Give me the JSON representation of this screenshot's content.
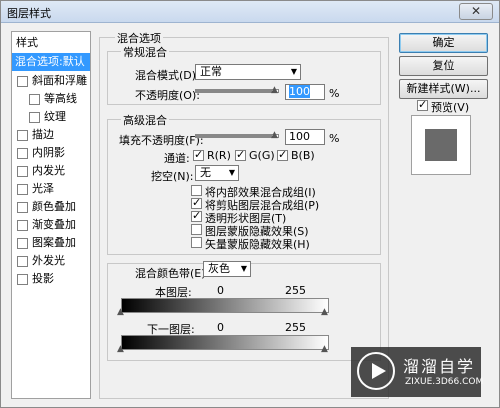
{
  "window": {
    "title": "图层样式",
    "close": "✕"
  },
  "stylelist": {
    "header": "样式",
    "items": [
      {
        "label": "混合选项:默认",
        "selected": true
      },
      {
        "label": "斜面和浮雕",
        "checked": false
      },
      {
        "label": "等高线",
        "checked": false
      },
      {
        "label": "纹理",
        "checked": false
      },
      {
        "label": "描边",
        "checked": false
      },
      {
        "label": "内阴影",
        "checked": false
      },
      {
        "label": "内发光",
        "checked": false
      },
      {
        "label": "光泽",
        "checked": false
      },
      {
        "label": "颜色叠加",
        "checked": false
      },
      {
        "label": "渐变叠加",
        "checked": false
      },
      {
        "label": "图案叠加",
        "checked": false
      },
      {
        "label": "外发光",
        "checked": false
      },
      {
        "label": "投影",
        "checked": false
      }
    ]
  },
  "blend_options": {
    "title": "混合选项",
    "general": {
      "title": "常规混合",
      "mode_label": "混合模式(D):",
      "mode_value": "正常",
      "opacity_label": "不透明度(O):",
      "opacity_value": "100",
      "opacity_unit": "%",
      "opacity_level": 1.0
    },
    "advanced": {
      "title": "高级混合",
      "fill_label": "填充不透明度(F):",
      "fill_value": "100",
      "fill_unit": "%",
      "fill_level": 1.0,
      "channels_label": "通道:",
      "channels": [
        {
          "label": "R(R)",
          "checked": true
        },
        {
          "label": "G(G)",
          "checked": true
        },
        {
          "label": "B(B)",
          "checked": true
        }
      ],
      "knockout_label": "挖空(N):",
      "knockout_value": "无",
      "options": [
        {
          "label": "将内部效果混合成组(I)",
          "checked": false
        },
        {
          "label": "将剪贴图层混合成组(P)",
          "checked": true
        },
        {
          "label": "透明形状图层(T)",
          "checked": true
        },
        {
          "label": "图层蒙版隐藏效果(S)",
          "checked": false
        },
        {
          "label": "矢量蒙版隐藏效果(H)",
          "checked": false
        }
      ]
    },
    "blend_if": {
      "label": "混合颜色带(E):",
      "value": "灰色",
      "this_layer": {
        "label": "本图层:",
        "min": "0",
        "max": "255"
      },
      "underlying": {
        "label": "下一图层:",
        "min": "0",
        "max": "255"
      }
    }
  },
  "buttons": {
    "ok": "确定",
    "reset": "复位",
    "new_style": "新建样式(W)...",
    "preview_label": "预览(V)",
    "preview_checked": true
  },
  "colors": {
    "selection": "#3399ff",
    "preview_swatch": "#6a6a6a"
  },
  "watermark": {
    "name": "溜溜自学",
    "url": "ZIXUE.3D66.COM"
  }
}
